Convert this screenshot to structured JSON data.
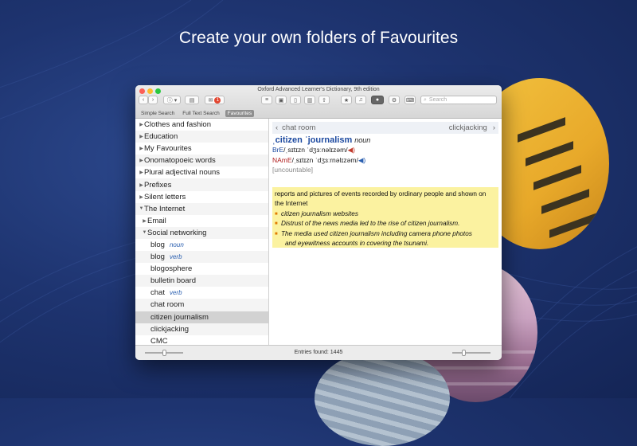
{
  "headline": "Create your own folders of Favourites",
  "window": {
    "title": "Oxford Advanced Learner's Dictionary, 9th edition",
    "search_placeholder": "Search",
    "badge": "1"
  },
  "tabs": [
    {
      "label": "Simple Search"
    },
    {
      "label": "Full Text Search"
    },
    {
      "label": "Favourites"
    }
  ],
  "sidebar": {
    "items": [
      {
        "label": "Clothes and fashion",
        "pos": ""
      },
      {
        "label": "Education",
        "pos": ""
      },
      {
        "label": "My Favourites",
        "pos": ""
      },
      {
        "label": "Onomatopoeic words",
        "pos": ""
      },
      {
        "label": "Plural adjectival nouns",
        "pos": ""
      },
      {
        "label": "Prefixes",
        "pos": ""
      },
      {
        "label": "Silent letters",
        "pos": ""
      },
      {
        "label": "The Internet",
        "pos": ""
      },
      {
        "label": "Email",
        "pos": ""
      },
      {
        "label": "Social networking",
        "pos": ""
      },
      {
        "label": "blog",
        "pos": "noun"
      },
      {
        "label": "blog",
        "pos": "verb"
      },
      {
        "label": "blogosphere",
        "pos": ""
      },
      {
        "label": "bulletin board",
        "pos": ""
      },
      {
        "label": "chat",
        "pos": "verb"
      },
      {
        "label": "chat room",
        "pos": ""
      },
      {
        "label": "citizen journalism",
        "pos": ""
      },
      {
        "label": "clickjacking",
        "pos": ""
      },
      {
        "label": "CMC",
        "pos": ""
      }
    ]
  },
  "entry": {
    "prev": "chat room",
    "next": "clickjacking",
    "headword": "ˌcitizen ˈjournalism",
    "pos": "noun",
    "bre_label": "BrE",
    "bre_ipa": "/ˌsɪtɪzn ˈdʒɜːnəlɪzəm/",
    "name_label": "NAmE",
    "name_ipa": "/ˌsɪtɪzn ˈdʒɜːrnəlɪzəm/",
    "grammar": "[uncountable]",
    "definition": "reports and pictures of events recorded by ordinary people and shown on the Internet",
    "examples": [
      "citizen journalism websites",
      "Distrust of the news media led to the rise of citizen journalism.",
      "The media used citizen journalism including camera phone photos"
    ],
    "example_cont": "and eyewitness accounts in covering the tsunami."
  },
  "status": {
    "entries": "Entries found: 1445"
  }
}
